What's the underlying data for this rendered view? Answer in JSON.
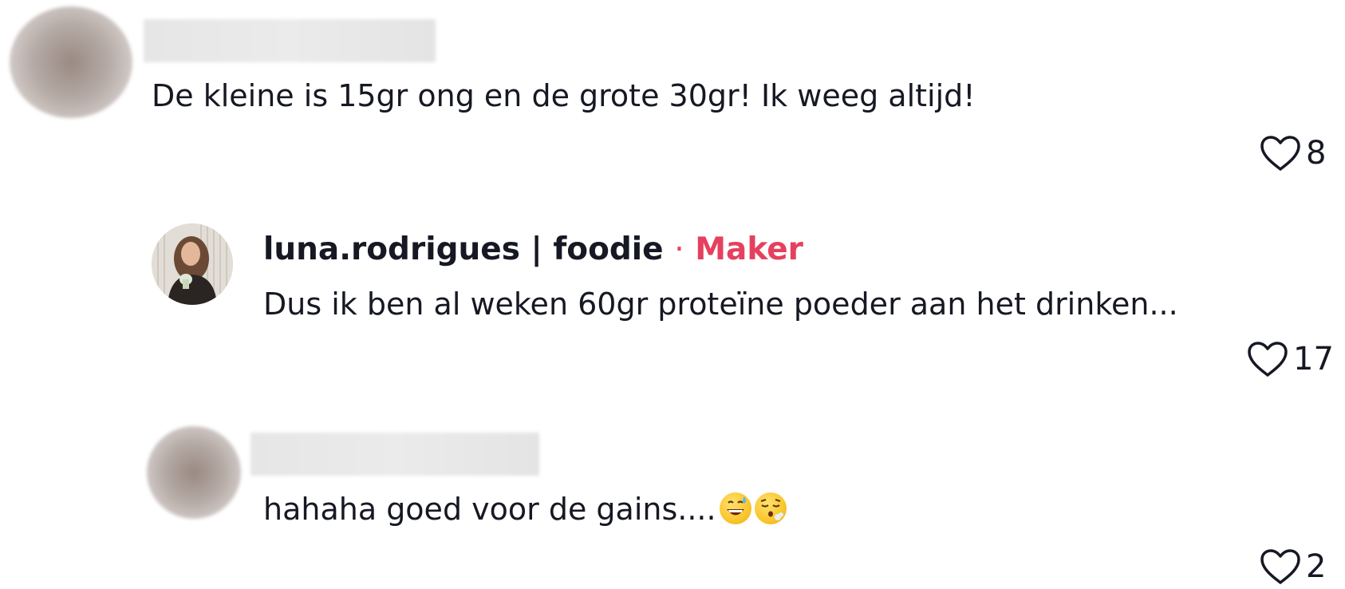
{
  "comments": [
    {
      "author": "",
      "text": "De kleine is 15gr ong en de grote 30gr! Ik weeg altijd!",
      "likes": "8"
    },
    {
      "author": "luna.rodrigues | foodie",
      "separator": "·",
      "badge": "Maker",
      "text": "Dus ik ben al weken 60gr proteïne poeder aan het drinken...",
      "likes": "17"
    },
    {
      "author": "",
      "text": "hahaha goed voor de gains....",
      "emojis": [
        "grinning-sweat-emoji",
        "exhaling-face-emoji"
      ],
      "likes": "2"
    }
  ],
  "colors": {
    "badge": "#e5405e",
    "text": "#161823",
    "icon": "#161823"
  },
  "icons": {
    "like": "heart-outline-icon"
  }
}
